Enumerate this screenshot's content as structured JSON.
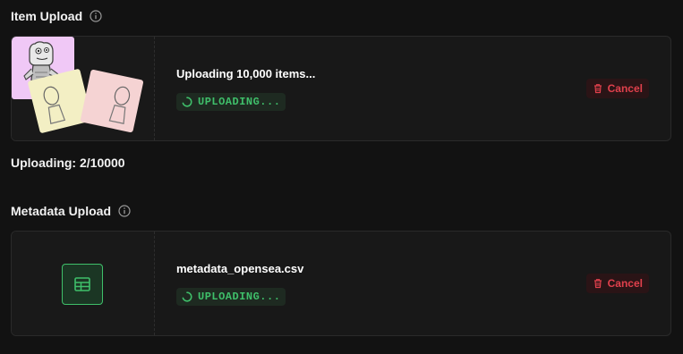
{
  "item_upload": {
    "title": "Item Upload",
    "card": {
      "title": "Uploading 10,000 items...",
      "status": "UPLOADING...",
      "cancel_label": "Cancel"
    },
    "progress_text": "Uploading: 2/10000"
  },
  "metadata_upload": {
    "title": "Metadata Upload",
    "card": {
      "title": "metadata_opensea.csv",
      "status": "UPLOADING...",
      "cancel_label": "Cancel"
    }
  },
  "colors": {
    "background": "#121212",
    "card": "#181818",
    "status_green": "#3fbf6a",
    "cancel_red": "#e0404c"
  },
  "icons": [
    "info-icon",
    "spinner-icon",
    "trash-icon",
    "table-icon"
  ]
}
